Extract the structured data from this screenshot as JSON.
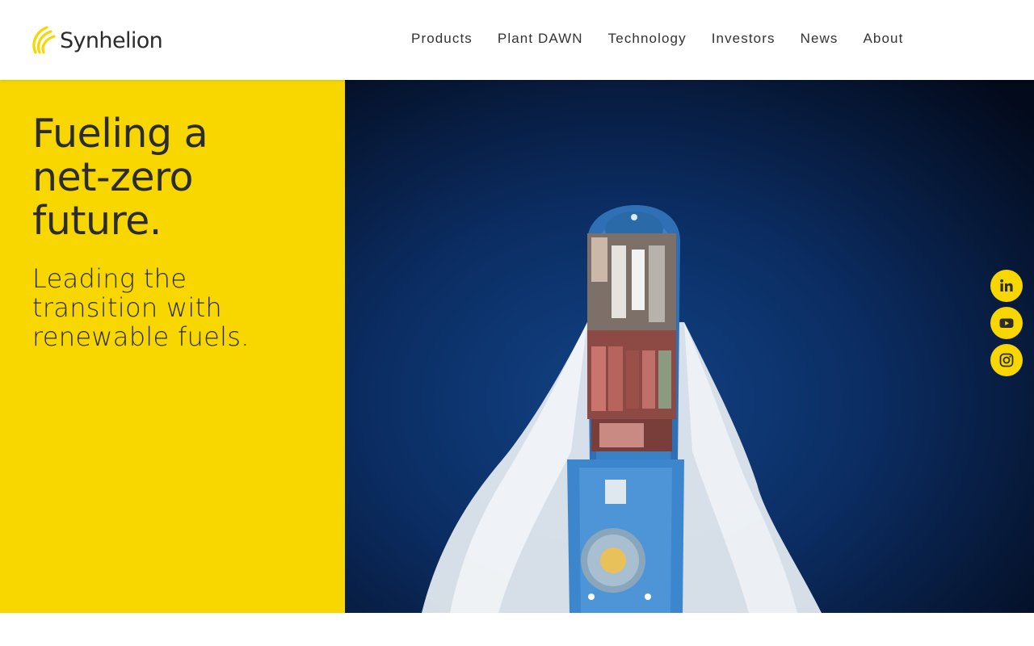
{
  "brand": {
    "name": "Synhelion",
    "accent_color": "#f8d700",
    "text_color": "#2c2c2c"
  },
  "nav": {
    "items": [
      {
        "label": "Products"
      },
      {
        "label": "Plant DAWN"
      },
      {
        "label": "Technology"
      },
      {
        "label": "Investors"
      },
      {
        "label": "News"
      },
      {
        "label": "About"
      }
    ]
  },
  "hero": {
    "title_lines": [
      "Fueling a",
      "net-zero",
      "future."
    ],
    "subtitle_lines": [
      "Leading the",
      "transition with",
      "renewable fuels."
    ],
    "media": {
      "kind": "video-still",
      "icon": "ship-aerial-image"
    }
  },
  "social": [
    {
      "name": "LinkedIn",
      "icon": "linkedin-icon"
    },
    {
      "name": "YouTube",
      "icon": "youtube-icon"
    },
    {
      "name": "Instagram",
      "icon": "instagram-icon"
    }
  ]
}
